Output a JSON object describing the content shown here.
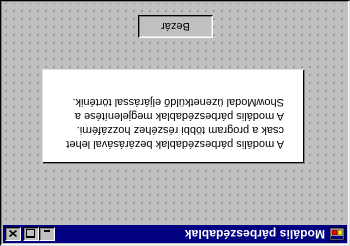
{
  "window": {
    "title": "Modális párbeszédablak",
    "icon": "app-icon",
    "controls": {
      "minimize_icon": "minimize-icon",
      "maximize_icon": "maximize-icon",
      "close_icon": "close-icon"
    }
  },
  "message": {
    "lines": [
      "A modális párbeszédablak bezárásával lehet",
      "csak a program többi részéhez hozzáférni.",
      "A modális párbeszédablak megjelenítése a",
      "ShowModal üzenetküldő eljárással történik."
    ]
  },
  "button": {
    "label": "Bezár"
  },
  "colors": {
    "titlebar": "#000080",
    "face": "#c0c0c0",
    "panel": "#ffffff"
  }
}
